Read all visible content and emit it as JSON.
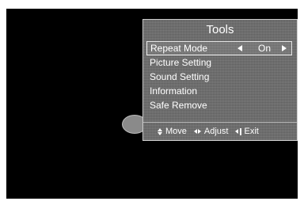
{
  "panel": {
    "title": "Tools"
  },
  "menu": {
    "items": [
      {
        "label": "Repeat Mode",
        "value": "On",
        "selected": true
      },
      {
        "label": "Picture Setting"
      },
      {
        "label": "Sound Setting"
      },
      {
        "label": "Information"
      },
      {
        "label": "Safe Remove"
      }
    ]
  },
  "footer": {
    "move": "Move",
    "adjust": "Adjust",
    "exit": "Exit",
    "icons": [
      "up-down-arrows-icon",
      "left-right-arrows-icon",
      "exit-icon"
    ]
  }
}
